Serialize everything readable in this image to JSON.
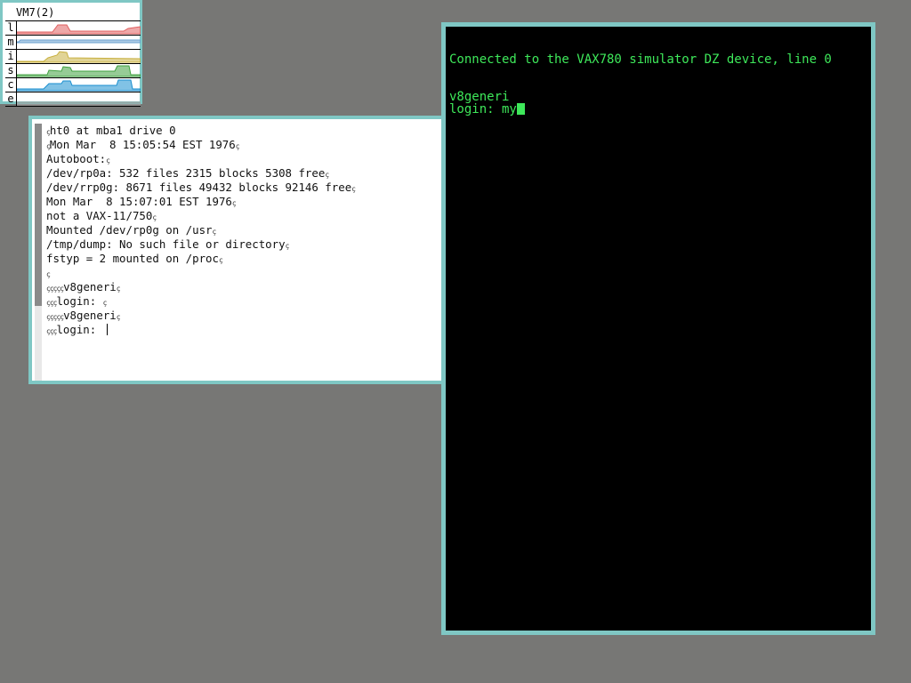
{
  "meter": {
    "title": "VM7(2)",
    "rows": [
      {
        "label": "l",
        "color": "#e06060"
      },
      {
        "label": "m",
        "color": "#6aa0d0"
      },
      {
        "label": "i",
        "color": "#c8b040"
      },
      {
        "label": "s",
        "color": "#40a040"
      },
      {
        "label": "c",
        "color": "#1a8fd0"
      },
      {
        "label": "e",
        "color": "#a0a0a0"
      }
    ]
  },
  "console": {
    "lines": [
      {
        "pre": "ç",
        "text": "ht0 at mba1 drive 0",
        "post": ""
      },
      {
        "pre": "ç",
        "text": "Mon Mar  8 15:05:54 EST 1976",
        "post": "ç"
      },
      {
        "pre": "",
        "text": "Autoboot:",
        "post": "ç"
      },
      {
        "pre": "",
        "text": "/dev/rp0a: 532 files 2315 blocks 5308 free",
        "post": "ç"
      },
      {
        "pre": "",
        "text": "/dev/rrp0g: 8671 files 49432 blocks 92146 free",
        "post": "ç"
      },
      {
        "pre": "",
        "text": "Mon Mar  8 15:07:01 EST 1976",
        "post": "ç"
      },
      {
        "pre": "",
        "text": "not a VAX-11/750",
        "post": "ç"
      },
      {
        "pre": "",
        "text": "Mounted /dev/rp0g on /usr",
        "post": "ç"
      },
      {
        "pre": "",
        "text": "/tmp/dump: No such file or directory",
        "post": "ç"
      },
      {
        "pre": "",
        "text": "fstyp = 2 mounted on /proc",
        "post": "ç"
      },
      {
        "pre": "ç",
        "text": "",
        "post": ""
      },
      {
        "pre": "ççççç",
        "text": "v8generi",
        "post": "ç"
      },
      {
        "pre": "ççç",
        "text": "login: ",
        "post": "ç"
      },
      {
        "pre": "ççççç",
        "text": "v8generi",
        "post": "ç"
      },
      {
        "pre": "ççç",
        "text": "login: ",
        "post": ""
      }
    ]
  },
  "terminal": {
    "lines": [
      "Connected to the VAX780 simulator DZ device, line 0",
      "",
      "",
      "v8generi",
      "login: my"
    ],
    "text_color": "#3ee85a"
  }
}
